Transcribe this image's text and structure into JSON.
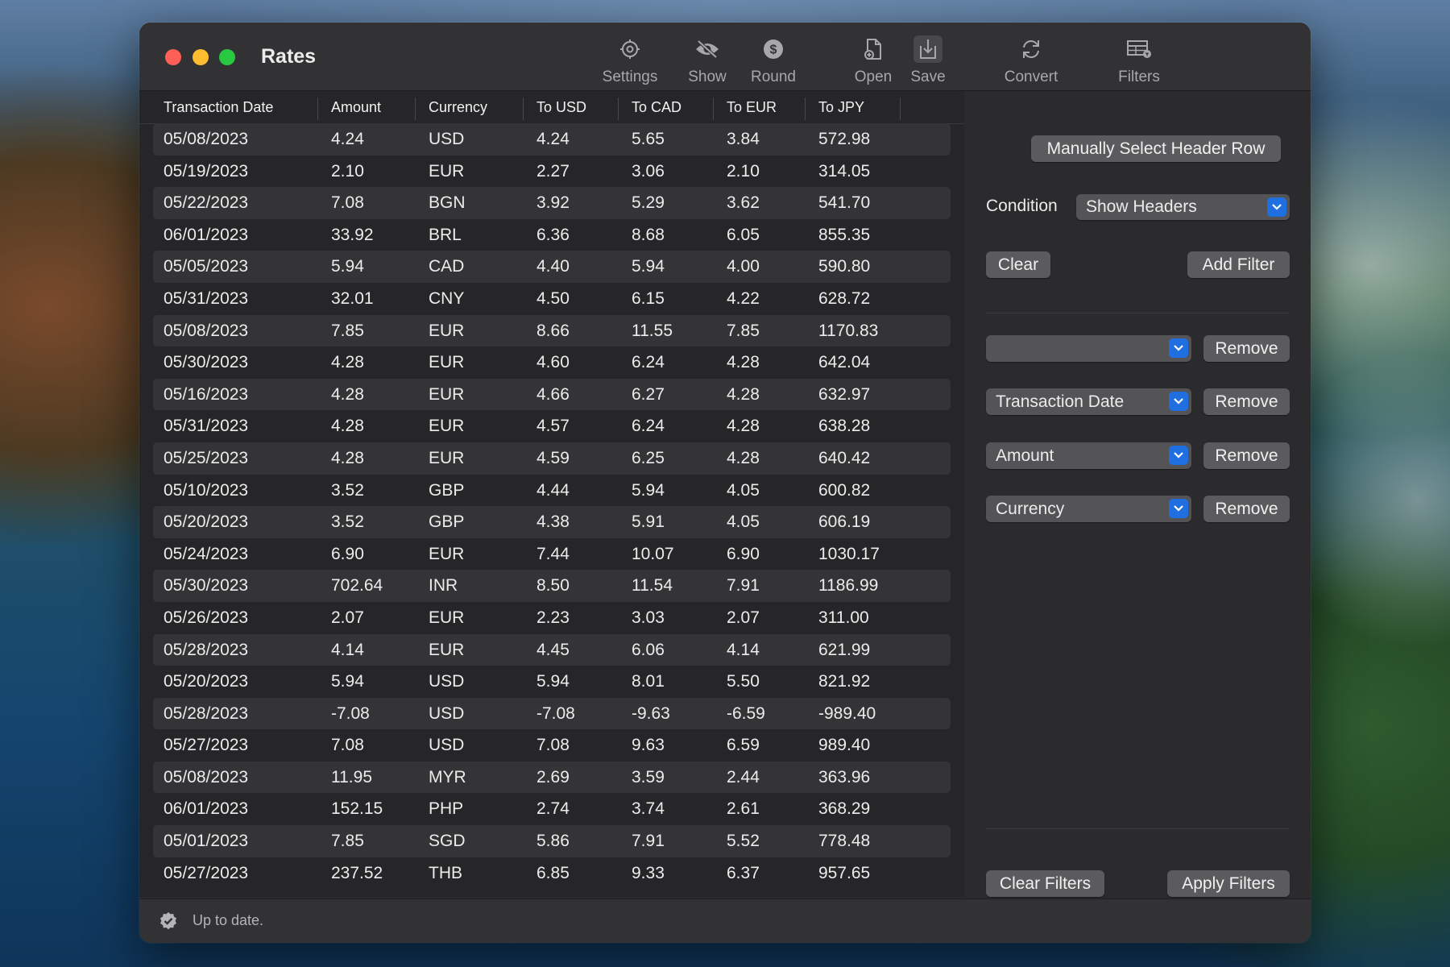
{
  "window": {
    "title": "Rates"
  },
  "toolbar": [
    {
      "label": "Settings",
      "icon": "gear-icon"
    },
    {
      "label": "Show",
      "icon": "eye-slash-icon"
    },
    {
      "label": "Round",
      "icon": "dollar-circle-icon"
    },
    {
      "label": "Open",
      "icon": "open-document-icon"
    },
    {
      "label": "Save",
      "icon": "save-download-icon"
    },
    {
      "label": "Convert",
      "icon": "convert-arrows-icon"
    },
    {
      "label": "Filters",
      "icon": "table-filter-icon"
    }
  ],
  "table": {
    "columns": [
      "Transaction Date",
      "Amount",
      "Currency",
      "To USD",
      "To CAD",
      "To EUR",
      "To JPY"
    ],
    "rows": [
      [
        "05/08/2023",
        "4.24",
        "USD",
        "4.24",
        "5.65",
        "3.84",
        "572.98"
      ],
      [
        "05/19/2023",
        "2.10",
        "EUR",
        "2.27",
        "3.06",
        "2.10",
        "314.05"
      ],
      [
        "05/22/2023",
        "7.08",
        "BGN",
        "3.92",
        "5.29",
        "3.62",
        "541.70"
      ],
      [
        "06/01/2023",
        "33.92",
        "BRL",
        "6.36",
        "8.68",
        "6.05",
        "855.35"
      ],
      [
        "05/05/2023",
        "5.94",
        "CAD",
        "4.40",
        "5.94",
        "4.00",
        "590.80"
      ],
      [
        "05/31/2023",
        "32.01",
        "CNY",
        "4.50",
        "6.15",
        "4.22",
        "628.72"
      ],
      [
        "05/08/2023",
        "7.85",
        "EUR",
        "8.66",
        "11.55",
        "7.85",
        "1170.83"
      ],
      [
        "05/30/2023",
        "4.28",
        "EUR",
        "4.60",
        "6.24",
        "4.28",
        "642.04"
      ],
      [
        "05/16/2023",
        "4.28",
        "EUR",
        "4.66",
        "6.27",
        "4.28",
        "632.97"
      ],
      [
        "05/31/2023",
        "4.28",
        "EUR",
        "4.57",
        "6.24",
        "4.28",
        "638.28"
      ],
      [
        "05/25/2023",
        "4.28",
        "EUR",
        "4.59",
        "6.25",
        "4.28",
        "640.42"
      ],
      [
        "05/10/2023",
        "3.52",
        "GBP",
        "4.44",
        "5.94",
        "4.05",
        "600.82"
      ],
      [
        "05/20/2023",
        "3.52",
        "GBP",
        "4.38",
        "5.91",
        "4.05",
        "606.19"
      ],
      [
        "05/24/2023",
        "6.90",
        "EUR",
        "7.44",
        "10.07",
        "6.90",
        "1030.17"
      ],
      [
        "05/30/2023",
        "702.64",
        "INR",
        "8.50",
        "11.54",
        "7.91",
        "1186.99"
      ],
      [
        "05/26/2023",
        "2.07",
        "EUR",
        "2.23",
        "3.03",
        "2.07",
        "311.00"
      ],
      [
        "05/28/2023",
        "4.14",
        "EUR",
        "4.45",
        "6.06",
        "4.14",
        "621.99"
      ],
      [
        "05/20/2023",
        "5.94",
        "USD",
        "5.94",
        "8.01",
        "5.50",
        "821.92"
      ],
      [
        "05/28/2023",
        "-7.08",
        "USD",
        "-7.08",
        "-9.63",
        "-6.59",
        "-989.40"
      ],
      [
        "05/27/2023",
        "7.08",
        "USD",
        "7.08",
        "9.63",
        "6.59",
        "989.40"
      ],
      [
        "05/08/2023",
        "11.95",
        "MYR",
        "2.69",
        "3.59",
        "2.44",
        "363.96"
      ],
      [
        "06/01/2023",
        "152.15",
        "PHP",
        "2.74",
        "3.74",
        "2.61",
        "368.29"
      ],
      [
        "05/01/2023",
        "7.85",
        "SGD",
        "5.86",
        "7.91",
        "5.52",
        "778.48"
      ],
      [
        "05/27/2023",
        "237.52",
        "THB",
        "6.85",
        "9.33",
        "6.37",
        "957.65"
      ]
    ]
  },
  "filters": {
    "manual_header_button": "Manually Select Header Row",
    "condition_label": "Condition",
    "condition_value": "Show Headers",
    "clear_button": "Clear",
    "add_filter_button": "Add Filter",
    "filter_rows": [
      {
        "field": "",
        "remove_label": "Remove"
      },
      {
        "field": "Transaction Date",
        "remove_label": "Remove"
      },
      {
        "field": "Amount",
        "remove_label": "Remove"
      },
      {
        "field": "Currency",
        "remove_label": "Remove"
      }
    ],
    "clear_filters_button": "Clear Filters",
    "apply_filters_button": "Apply Filters"
  },
  "status": {
    "text": "Up to date."
  },
  "colors": {
    "accent": "#1f6fe0",
    "close": "#fe5f57",
    "minimize": "#febc2e",
    "zoom": "#28c840"
  }
}
